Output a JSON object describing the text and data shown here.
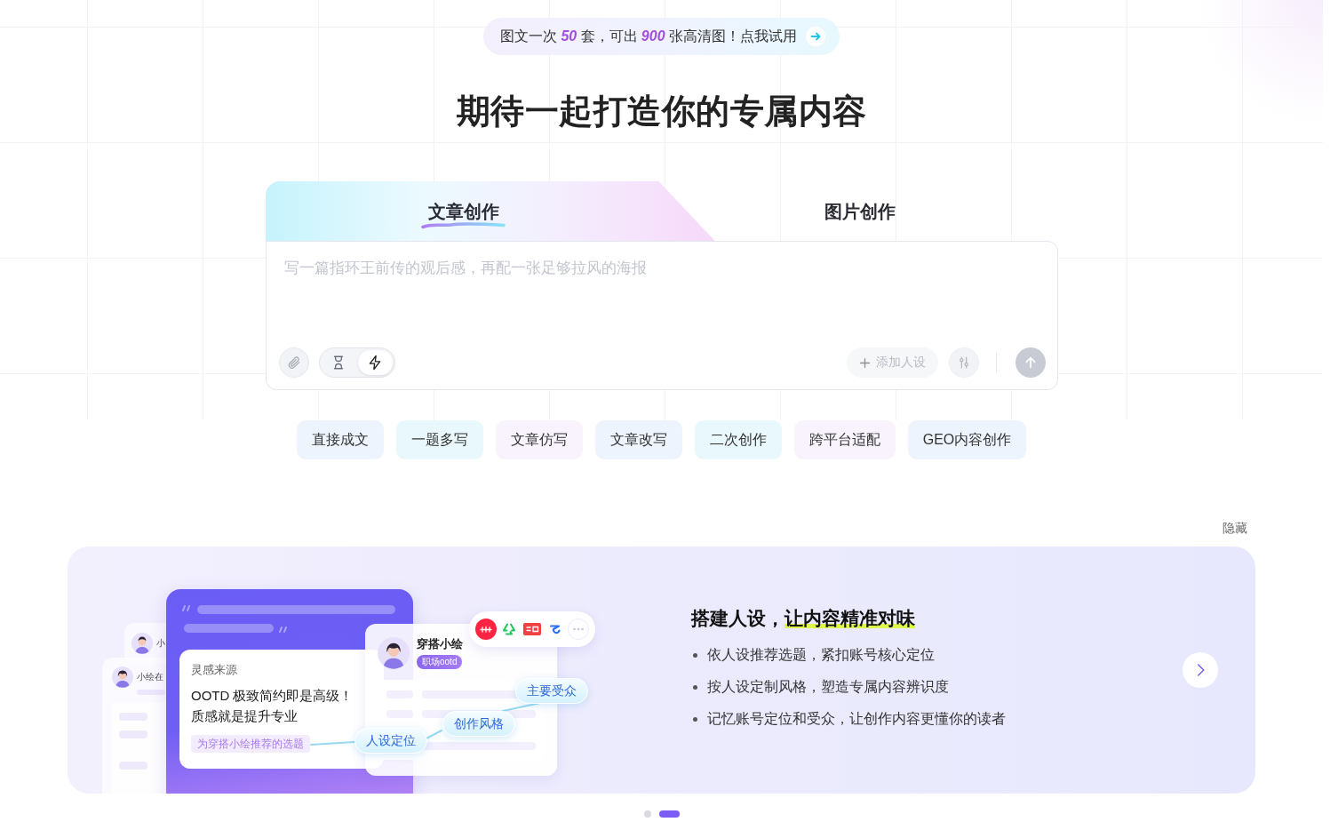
{
  "promo": {
    "text": "图文一次 **50** 套，可出 **900** 张高清图！点我试用"
  },
  "headline": "期待一起打造你的专属内容",
  "tabs": [
    {
      "label": "文章创作",
      "selected": true
    },
    {
      "label": "图片创作",
      "selected": false
    }
  ],
  "composer": {
    "placeholder": "写一篇指环王前传的观后感，再配一张足够拉风的海报",
    "modes": [
      {
        "selected": false
      },
      {
        "selected": true
      }
    ],
    "add_persona_button": "添加人设",
    "send_button": {
      "disabled": true
    }
  },
  "chips": [
    {
      "label": "直接成文",
      "color": "#edf4fe"
    },
    {
      "label": "一题多写",
      "color": "#e9f8fd"
    },
    {
      "label": "文章仿写",
      "color": "#f9f3fe"
    },
    {
      "label": "文章改写",
      "color": "#edf4fe"
    },
    {
      "label": "二次创作",
      "color": "#e9f8fd"
    },
    {
      "label": "跨平台适配",
      "color": "#f9f3fe"
    },
    {
      "label": "GEO内容创作",
      "color": "#edf4fe"
    }
  ],
  "hide_link": "隐藏",
  "banner": {
    "illustration": {
      "back_cards": [
        {
          "name": "小"
        },
        {
          "name": "小绘在"
        }
      ],
      "inspiration_card": {
        "label": "灵感来源",
        "lines": [
          "OOTD 极致简约即是高级！",
          "质感就是提升专业"
        ],
        "tag": "为穿搭小绘推荐的选题"
      },
      "persona_card": {
        "name": "穿搭小绘",
        "tag": "职场ootd"
      },
      "bubbles": [
        "主要受众",
        "创作风格",
        "人设定位"
      ]
    },
    "title": {
      "lead": "搭建人设，",
      "highlight": "让内容精准对味"
    },
    "bullets": [
      "依人设推荐选题，紧扣账号核心定位",
      "按人设定制风格，塑造专属内容辨识度",
      "记忆账号定位和受众，让创作内容更懂你的读者"
    ]
  },
  "pagination": [
    {
      "selected": false
    },
    {
      "selected": true
    }
  ]
}
